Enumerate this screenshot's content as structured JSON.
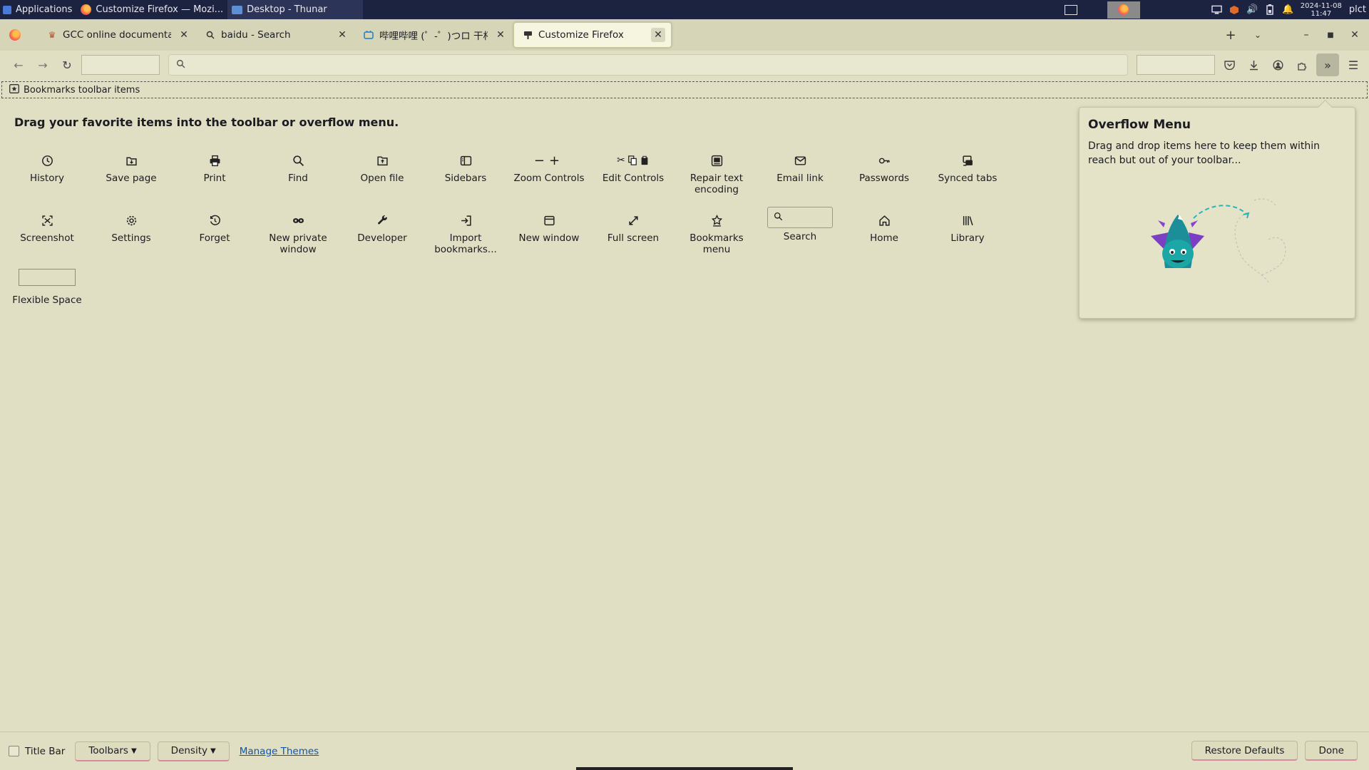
{
  "taskbar": {
    "applications_label": "Applications",
    "windows": [
      "Customize Firefox — Mozi...",
      "Desktop - Thunar"
    ],
    "clock_date": "2024-11-08",
    "clock_time": "11:47",
    "user": "plct"
  },
  "browser": {
    "tabs": [
      {
        "label": "GCC online documentation",
        "icon": "gcc-icon"
      },
      {
        "label": "baidu - Search",
        "icon": "search-icon"
      },
      {
        "label": "哔哩哔哩 (゜-゜)つロ 干杯~",
        "icon": "bilibili-icon"
      },
      {
        "label": "Customize Firefox",
        "icon": "customize-icon",
        "selected": true
      }
    ]
  },
  "bookmarks_toolbar": {
    "label": "Bookmarks toolbar items"
  },
  "palette": {
    "title": "Drag your favorite items into the toolbar or overflow menu.",
    "items": [
      {
        "label": "History",
        "icon": "history-icon"
      },
      {
        "label": "Save page",
        "icon": "save-page-icon"
      },
      {
        "label": "Print",
        "icon": "print-icon"
      },
      {
        "label": "Find",
        "icon": "find-icon"
      },
      {
        "label": "Open file",
        "icon": "open-file-icon"
      },
      {
        "label": "Sidebars",
        "icon": "sidebars-icon"
      },
      {
        "label": "Zoom Controls",
        "icon": "zoom-icon"
      },
      {
        "label": "Edit Controls",
        "icon": "edit-controls-icon"
      },
      {
        "label": "Repair text encoding",
        "icon": "text-encoding-icon"
      },
      {
        "label": "Email link",
        "icon": "email-icon"
      },
      {
        "label": "Passwords",
        "icon": "key-icon"
      },
      {
        "label": "Synced tabs",
        "icon": "synced-tabs-icon"
      },
      {
        "label": "Screenshot",
        "icon": "screenshot-icon"
      },
      {
        "label": "Settings",
        "icon": "gear-icon"
      },
      {
        "label": "Forget",
        "icon": "forget-icon"
      },
      {
        "label": "New private window",
        "icon": "private-mask-icon"
      },
      {
        "label": "Developer",
        "icon": "wrench-icon"
      },
      {
        "label": "Import bookmarks...",
        "icon": "import-icon"
      },
      {
        "label": "New window",
        "icon": "new-window-icon"
      },
      {
        "label": "Full screen",
        "icon": "fullscreen-icon"
      },
      {
        "label": "Bookmarks menu",
        "icon": "bookmarks-menu-icon"
      },
      {
        "label": "Search",
        "icon": "search-icon"
      },
      {
        "label": "Home",
        "icon": "home-icon"
      },
      {
        "label": "Library",
        "icon": "library-icon"
      },
      {
        "label": "Flexible Space",
        "icon": "flexible-space"
      }
    ]
  },
  "overflow_menu": {
    "title": "Overflow Menu",
    "text": "Drag and drop items here to keep them within reach but out of your toolbar..."
  },
  "footer": {
    "title_bar_label": "Title Bar",
    "toolbars_label": "Toolbars",
    "density_label": "Density",
    "manage_themes_label": "Manage Themes",
    "restore_label": "Restore Defaults",
    "done_label": "Done"
  }
}
